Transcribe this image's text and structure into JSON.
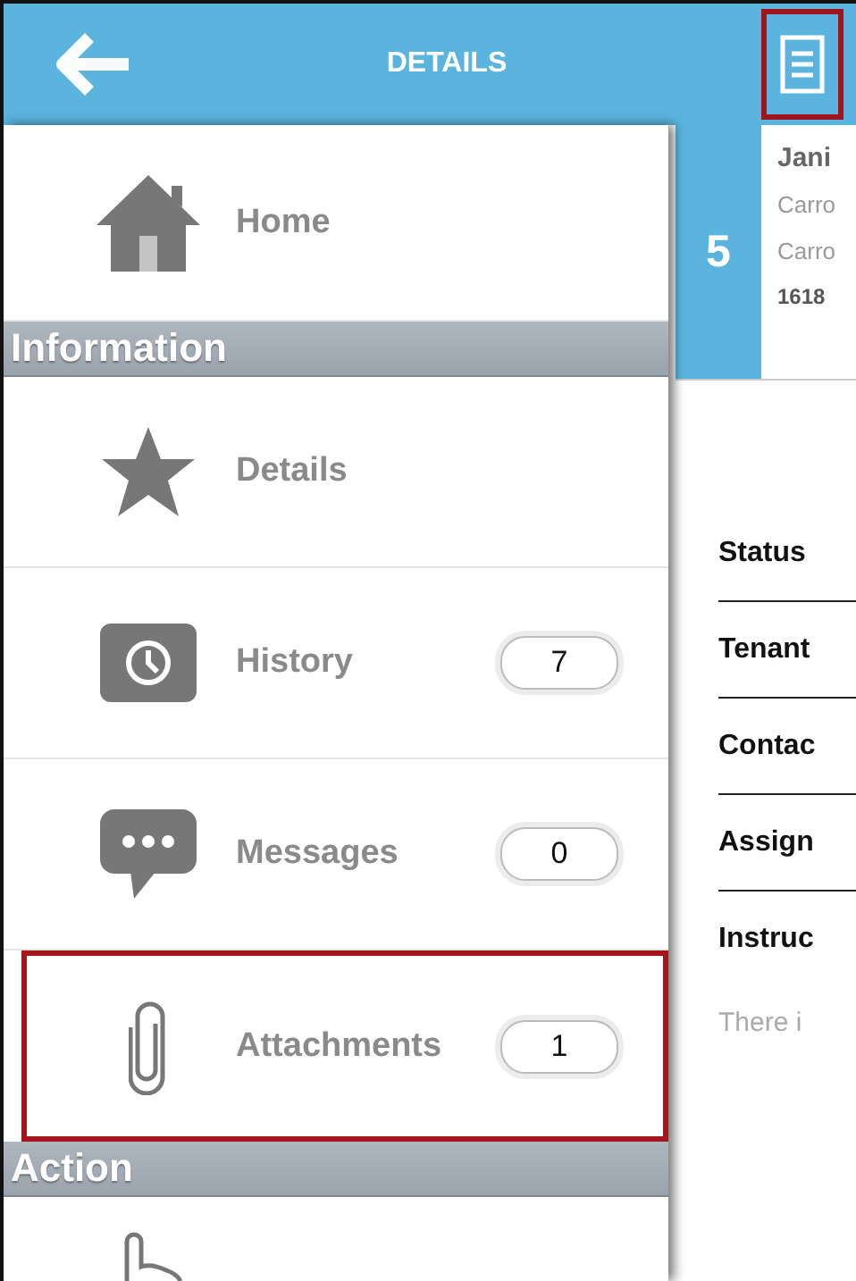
{
  "header": {
    "title": "DETAILS",
    "menu_button": {
      "highlighted": true
    }
  },
  "sidebar": {
    "items": [
      {
        "kind": "item",
        "label": "Home",
        "highlighted": false
      },
      {
        "kind": "header",
        "label": "Information"
      },
      {
        "kind": "item",
        "label": "Details",
        "highlighted": false
      },
      {
        "kind": "item",
        "label": "History",
        "count": "7",
        "highlighted": false
      },
      {
        "kind": "item",
        "label": "Messages",
        "count": "0",
        "highlighted": false
      },
      {
        "kind": "item",
        "label": "Attachments",
        "count": "1",
        "highlighted": true
      },
      {
        "kind": "header",
        "label": "Action"
      },
      {
        "kind": "item",
        "highlighted": false
      }
    ]
  },
  "job": {
    "number": "5",
    "lines": [
      "Jani",
      "Carro",
      "Carro",
      "1618"
    ]
  },
  "fields": [
    "Status",
    "Tenant",
    "Contac",
    "Assign",
    "Instruc"
  ],
  "note": "There i"
}
